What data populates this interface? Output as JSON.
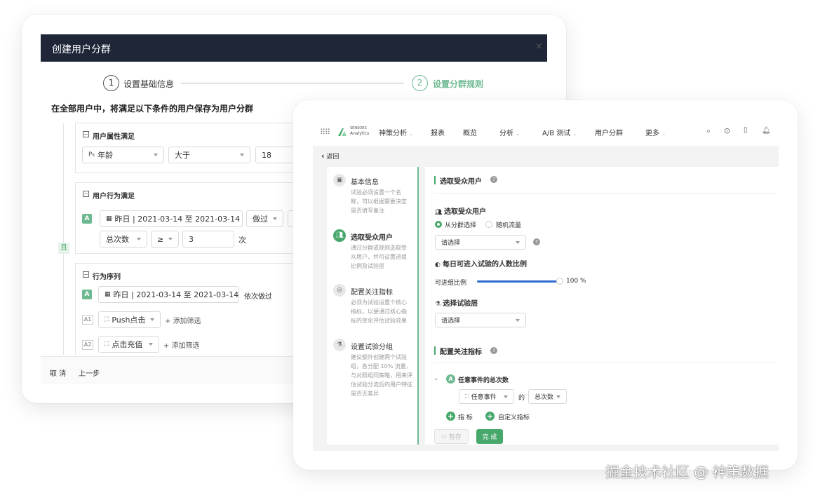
{
  "dialog": {
    "title": "创建用户分群",
    "close": "×",
    "step1_num": "1",
    "step1_label": "设置基础信息",
    "step2_num": "2",
    "step2_label": "设置分群规则",
    "description": "在全部用户中，将满足以下条件的用户保存为用户分群",
    "and_label": "且",
    "group1": {
      "title": "用户属性满足",
      "property": "年龄",
      "operator": "大于",
      "value": "18"
    },
    "group2": {
      "title": "用户行为满足",
      "badge": "A",
      "date_range": "昨日 | 2021-03-14 至 2021-03-14",
      "action": "做过",
      "metric": "总次数",
      "compare": "≥",
      "count": "3",
      "unit": "次"
    },
    "group3": {
      "title": "行为序列",
      "badge": "A",
      "date_range": "昨日 | 2021-03-14 至 2021-03-14",
      "order_label": "依次做过",
      "steps": [
        {
          "tag": "A1",
          "event": "Push点击",
          "add_filter": "添加筛选"
        },
        {
          "tag": "A2",
          "event": "点击充值",
          "add_filter": "添加筛选"
        }
      ]
    },
    "footer": {
      "cancel": "取 消",
      "prev": "上一步"
    }
  },
  "app": {
    "brand_top": "SENSORS",
    "brand_bottom": "Analytics",
    "product": "神策分析",
    "nav": [
      "报表",
      "概览",
      "分析",
      "A/B 测试",
      "用户分群",
      "更多"
    ],
    "back": "返回",
    "steps": [
      {
        "title": "基本信息",
        "desc": [
          "试验必须设置一个名",
          "称，可以根据需要决定",
          "是否填写备注"
        ]
      },
      {
        "title": "选取受众用户",
        "desc": [
          "通过分群或规则选取受",
          "众用户，并可设置进组",
          "比例及试验层"
        ]
      },
      {
        "title": "配置关注指标",
        "desc": [
          "必须为试验设置个核心",
          "指标，以便通过核心指",
          "标的变化评估试验效果"
        ]
      },
      {
        "title": "设置试验分组",
        "desc": [
          "建议额外创建两个试验",
          "组，各分配 10% 流量，",
          "与对照组同策略，用来评",
          "估试验分流后的用户特征",
          "是否无差异"
        ]
      }
    ],
    "section1": {
      "title": "选取受众用户",
      "sub1": "选取受众用户",
      "radio1": "从分群选择",
      "radio2": "随机流量",
      "select1_placeholder": "请选择",
      "sub2": "每日可进入试验的人数比例",
      "slider_label": "可进组比例",
      "slider_value_text": "100 %",
      "slider_fraction": 1.0,
      "sub3": "选择试验层",
      "select2_placeholder": "请选择"
    },
    "section2": {
      "title": "配置关注指标",
      "metric_badge": "A",
      "metric_title": "任意事件的总次数",
      "event_select": "任意事件",
      "of_label": "的",
      "agg_select": "总次数",
      "add_metric": "指 标",
      "add_custom": "自定义指标"
    },
    "buttons": {
      "save": "暂存",
      "done": "完 成"
    }
  },
  "watermark": "掘金技术社区 @ 神策数据",
  "colors": {
    "header_dark": "#1e2638",
    "accent_green": "#47a86b",
    "slider_blue": "#2f6bd1"
  }
}
